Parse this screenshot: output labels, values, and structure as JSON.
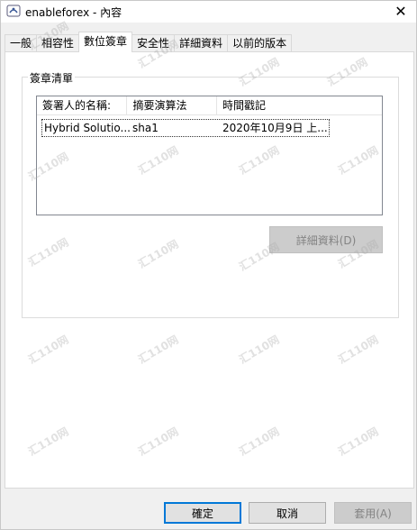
{
  "window": {
    "title": "enableforex - 內容",
    "close_glyph": "✕"
  },
  "tabs": [
    {
      "label": "一般",
      "active": false
    },
    {
      "label": "相容性",
      "active": false
    },
    {
      "label": "數位簽章",
      "active": true
    },
    {
      "label": "安全性",
      "active": false
    },
    {
      "label": "詳細資料",
      "active": false
    },
    {
      "label": "以前的版本",
      "active": false
    }
  ],
  "signature_group": {
    "legend": "簽章清單",
    "columns": [
      "簽署人的名稱:",
      "摘要演算法",
      "時間戳記"
    ],
    "rows": [
      {
        "name": "Hybrid Solutio...",
        "digest": "sha1",
        "timestamp": "2020年10月9日 上..."
      }
    ],
    "details_button": "詳細資料(D)"
  },
  "footer": {
    "ok": "確定",
    "cancel": "取消",
    "apply": "套用(A)"
  },
  "watermark_text": "汇110网",
  "colors": {
    "default_button_border": "#0078d7",
    "disabled_text": "#838383",
    "panel_bg": "#ffffff",
    "window_bg": "#f0f0f0"
  }
}
